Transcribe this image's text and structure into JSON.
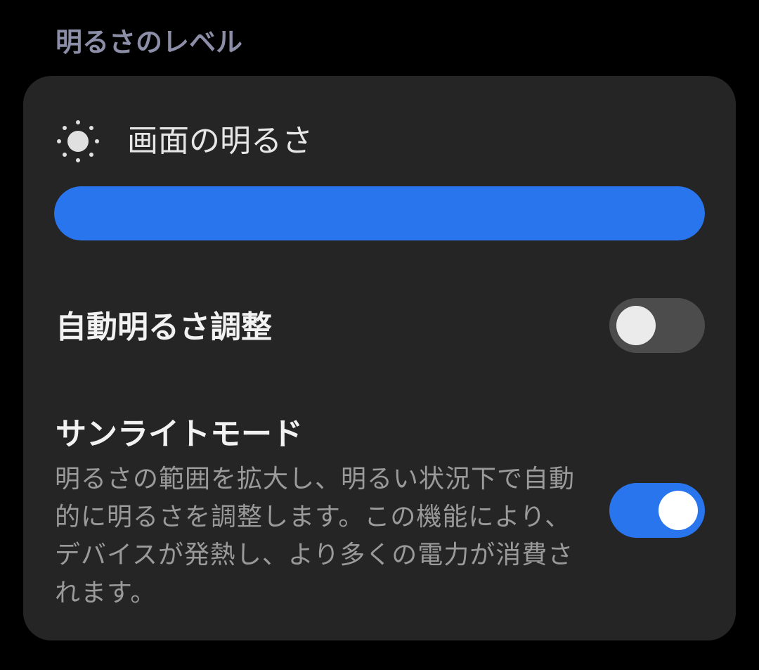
{
  "section_header": "明るさのレベル",
  "brightness": {
    "icon": "sun-icon",
    "title": "画面の明るさ",
    "level_percent": 100,
    "accent_color": "#2875ee"
  },
  "auto_brightness": {
    "title": "自動明るさ調整",
    "enabled": false
  },
  "sunlight_mode": {
    "title": "サンライトモード",
    "description": "明るさの範囲を拡大し、明るい状況下で自動的に明るさを調整します。この機能により、デバイスが発熱し、より多くの電力が消費されます。",
    "enabled": true
  },
  "colors": {
    "background": "#000000",
    "card": "#252525",
    "accent": "#2875ee",
    "header_text": "#8c8ea8"
  }
}
